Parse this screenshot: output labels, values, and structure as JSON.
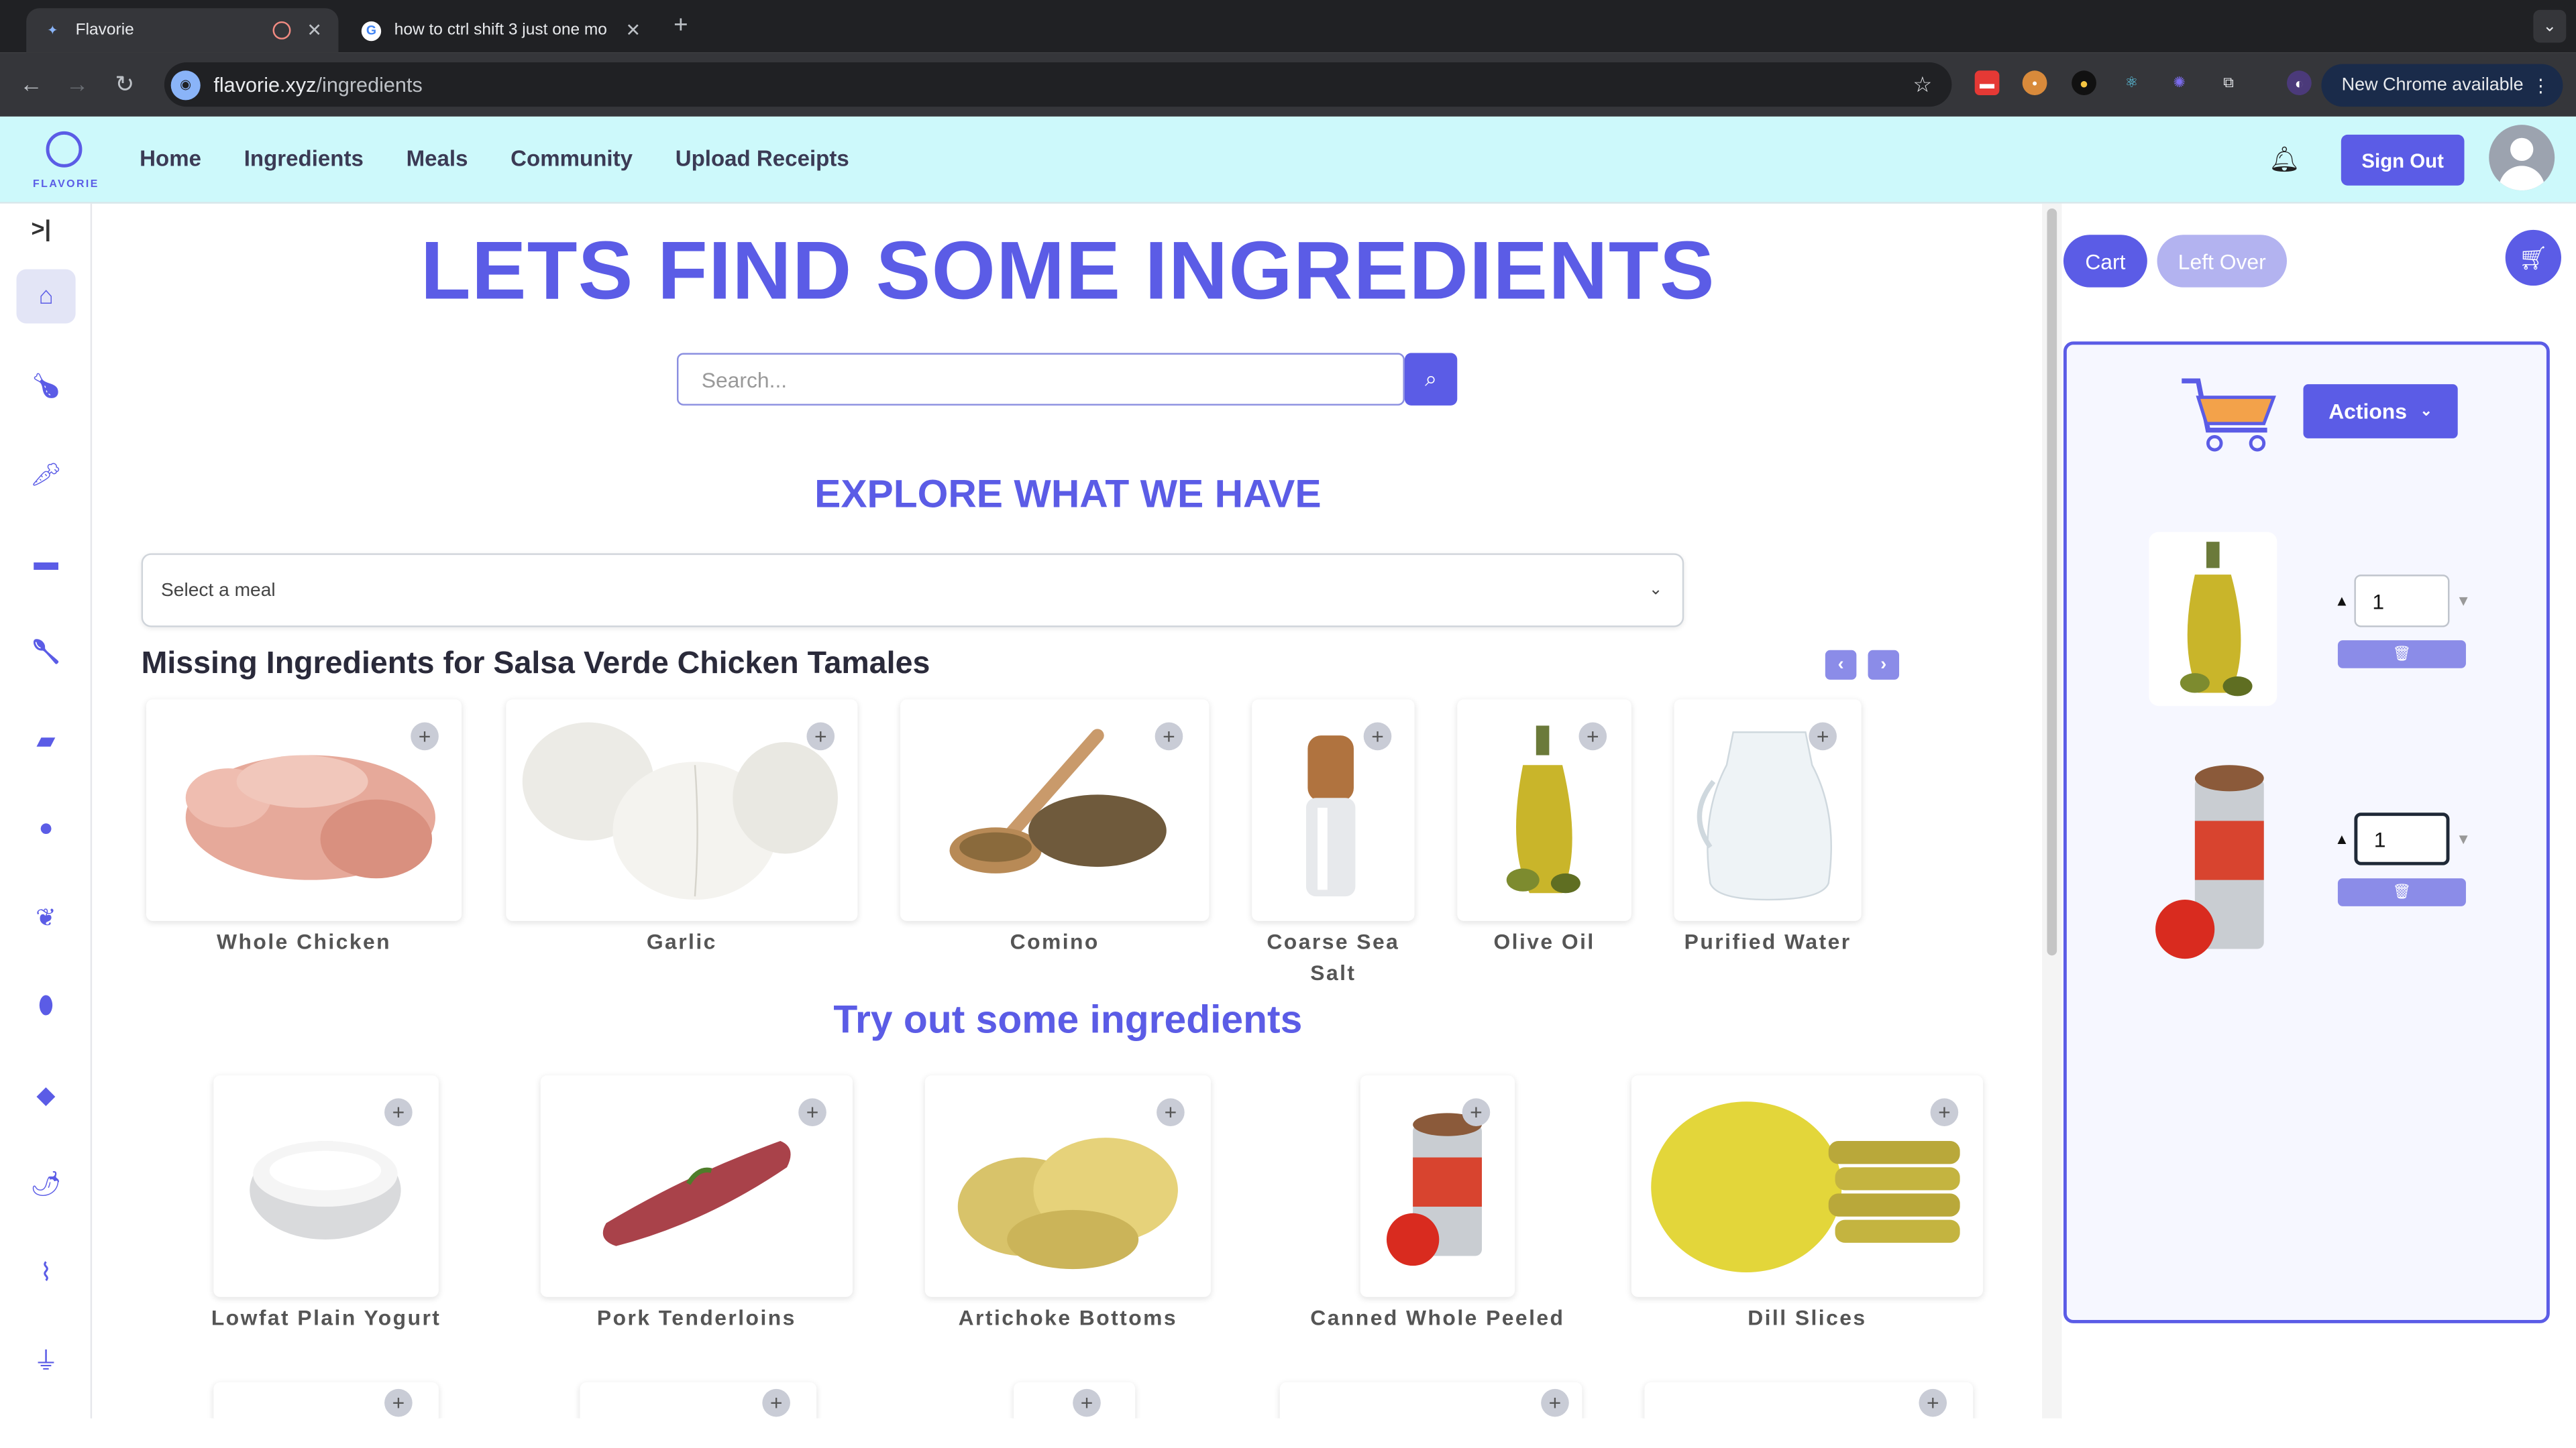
{
  "browser": {
    "tabs": [
      {
        "title": "Flavorie",
        "active": true
      },
      {
        "title": "how to ctrl shift 3 just one mo",
        "active": false
      }
    ],
    "url_host": "flavorie.xyz",
    "url_path": "/ingredients",
    "update_label": "New Chrome available"
  },
  "app": {
    "logo_text": "FLAVORIE",
    "nav": [
      "Home",
      "Ingredients",
      "Meals",
      "Community",
      "Upload Receipts"
    ],
    "sign_out": "Sign Out",
    "accent": "#5b5ce6"
  },
  "main": {
    "hero": "LETS FIND SOME INGREDIENTS",
    "search_placeholder": "Search...",
    "explore": "EXPLORE WHAT WE HAVE",
    "select_placeholder": "Select a meal",
    "missing_title": "Missing Ingredients for Salsa Verde Chicken Tamales",
    "missing_items": [
      "Whole Chicken",
      "Garlic",
      "Comino",
      "Coarse Sea Salt",
      "Olive Oil",
      "Purified Water"
    ],
    "tryout_title": "Try out some ingredients",
    "tryout_items": [
      "Lowfat Plain Yogurt",
      "Pork Tenderloins",
      "Artichoke Bottoms",
      "Canned Whole Peeled",
      "Dill Slices"
    ]
  },
  "cart": {
    "tab_cart": "Cart",
    "tab_leftover": "Left Over",
    "actions": "Actions",
    "items": [
      {
        "name": "Olive Oil",
        "qty": "1"
      },
      {
        "name": "Canned Whole Peeled",
        "qty": "1"
      }
    ]
  }
}
